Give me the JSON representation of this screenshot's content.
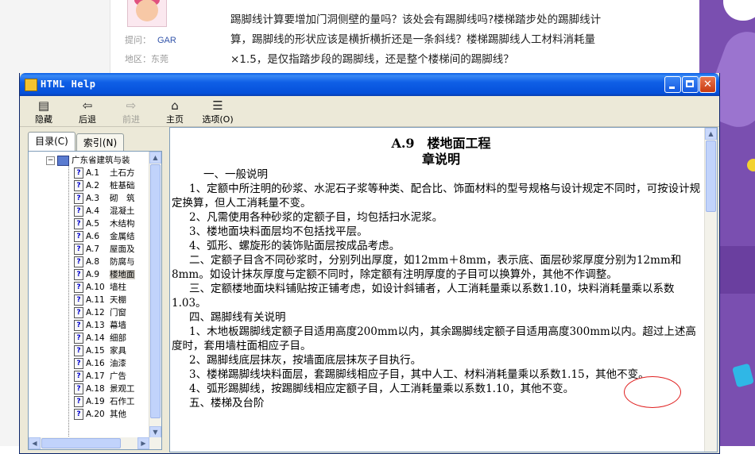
{
  "background_page": {
    "meta_raised_label": "提问：",
    "meta_raised_value": "GAR",
    "meta_area_label": "地区：",
    "meta_area_value": "东莞",
    "question_lines": [
      "踢脚线计算要增加门洞侧壁的量吗？该处会有踢脚线吗?楼梯踏步处的踢脚线计",
      "算，踢脚线的形状应该是横折横折还是一条斜线？楼梯踢脚线人工材料消耗量",
      "×1.5，是仅指踏步段的踢脚线，还是整个楼梯间的踢脚线？"
    ]
  },
  "window": {
    "title": "HTML Help",
    "buttons": {
      "minimize": "_",
      "maximize": "□",
      "close": "✕"
    },
    "toolbar": [
      {
        "label": "隐藏",
        "icon": "hide-icon",
        "glyph": "▤",
        "enabled": true
      },
      {
        "label": "后退",
        "icon": "back-icon",
        "glyph": "⇦",
        "enabled": true
      },
      {
        "label": "前进",
        "icon": "forward-icon",
        "glyph": "⇨",
        "enabled": false
      },
      {
        "label": "主页",
        "icon": "home-icon",
        "glyph": "⌂",
        "enabled": true
      },
      {
        "label": "选项(O)",
        "icon": "options-icon",
        "glyph": "☰",
        "enabled": true
      }
    ]
  },
  "nav": {
    "tabs": [
      {
        "label": "目录(C)",
        "active": true
      },
      {
        "label": "索引(N)",
        "active": false
      }
    ],
    "root": "广东省建筑与装",
    "items": [
      {
        "code": "A.1",
        "name": "土石方"
      },
      {
        "code": "A.2",
        "name": "桩基础"
      },
      {
        "code": "A.3",
        "name": "砌　筑"
      },
      {
        "code": "A.4",
        "name": "混凝土"
      },
      {
        "code": "A.5",
        "name": "木结构"
      },
      {
        "code": "A.6",
        "name": "金属结"
      },
      {
        "code": "A.7",
        "name": "屋面及"
      },
      {
        "code": "A.8",
        "name": "防腐与"
      },
      {
        "code": "A.9",
        "name": "楼地面",
        "selected": true
      },
      {
        "code": "A.10",
        "name": "墙柱"
      },
      {
        "code": "A.11",
        "name": "天棚"
      },
      {
        "code": "A.12",
        "name": "门窗"
      },
      {
        "code": "A.13",
        "name": "幕墙"
      },
      {
        "code": "A.14",
        "name": "细部"
      },
      {
        "code": "A.15",
        "name": "家具"
      },
      {
        "code": "A.16",
        "name": "油漆"
      },
      {
        "code": "A.17",
        "name": "广告"
      },
      {
        "code": "A.18",
        "name": "景观工"
      },
      {
        "code": "A.19",
        "name": "石作工"
      },
      {
        "code": "A.20",
        "name": "其他"
      }
    ]
  },
  "content": {
    "heading": "A.9　楼地面工程",
    "subheading": "章说明",
    "paragraphs": [
      {
        "cls": "ind1",
        "text": "一、一般说明"
      },
      {
        "cls": "ind2",
        "text": "1、定额中所注明的砂浆、水泥石子浆等种类、配合比、饰面材料的型号规格与设计规定不同时，可按设计规定换算，但人工消耗量不变。"
      },
      {
        "cls": "ind2",
        "text": "2、凡需使用各种砂浆的定额子目，均包括扫水泥浆。"
      },
      {
        "cls": "ind2",
        "text": "3、楼地面块料面层均不包括找平层。"
      },
      {
        "cls": "ind2",
        "text": "4、弧形、螺旋形的装饰贴面层按成品考虑。"
      },
      {
        "cls": "ind2",
        "text": "二、定额子目含不同砂浆时，分别列出厚度，如12mm＋8mm，表示底、面层砂浆厚度分别为12mm和8mm。如设计抹灰厚度与定额不同时，除定额有注明厚度的子目可以换算外，其他不作调整。"
      },
      {
        "cls": "ind2",
        "text": "三、定额楼地面块料铺贴按正铺考虑，如设计斜铺者，人工消耗量乘以系数1.10，块料消耗量乘以系数1.03。"
      },
      {
        "cls": "ind2",
        "text": "四、踢脚线有关说明"
      },
      {
        "cls": "ind2",
        "text": "1、木地板踢脚线定额子目适用高度200mm以内，其余踢脚线定额子目适用高度300mm以内。超过上述高度时，套用墙柱面相应子目。"
      },
      {
        "cls": "ind2",
        "text": "2、踢脚线底层抹灰，按墙面底层抹灰子目执行。"
      },
      {
        "cls": "ind2",
        "text": "3、楼梯踢脚线块料面层，套踢脚线相应子目，其中人工、材料消耗量乘以系数1.15，其他不变。"
      },
      {
        "cls": "ind2",
        "text": "4、弧形踢脚线，按踢脚线相应定额子目，人工消耗量乘以系数1.10，其他不变。"
      },
      {
        "cls": "ind2",
        "text": "五、楼梯及台阶"
      }
    ]
  },
  "colors": {
    "titlebar": "#0a5de5",
    "annotation": "#e02020",
    "window_bg": "#ece9d8"
  }
}
